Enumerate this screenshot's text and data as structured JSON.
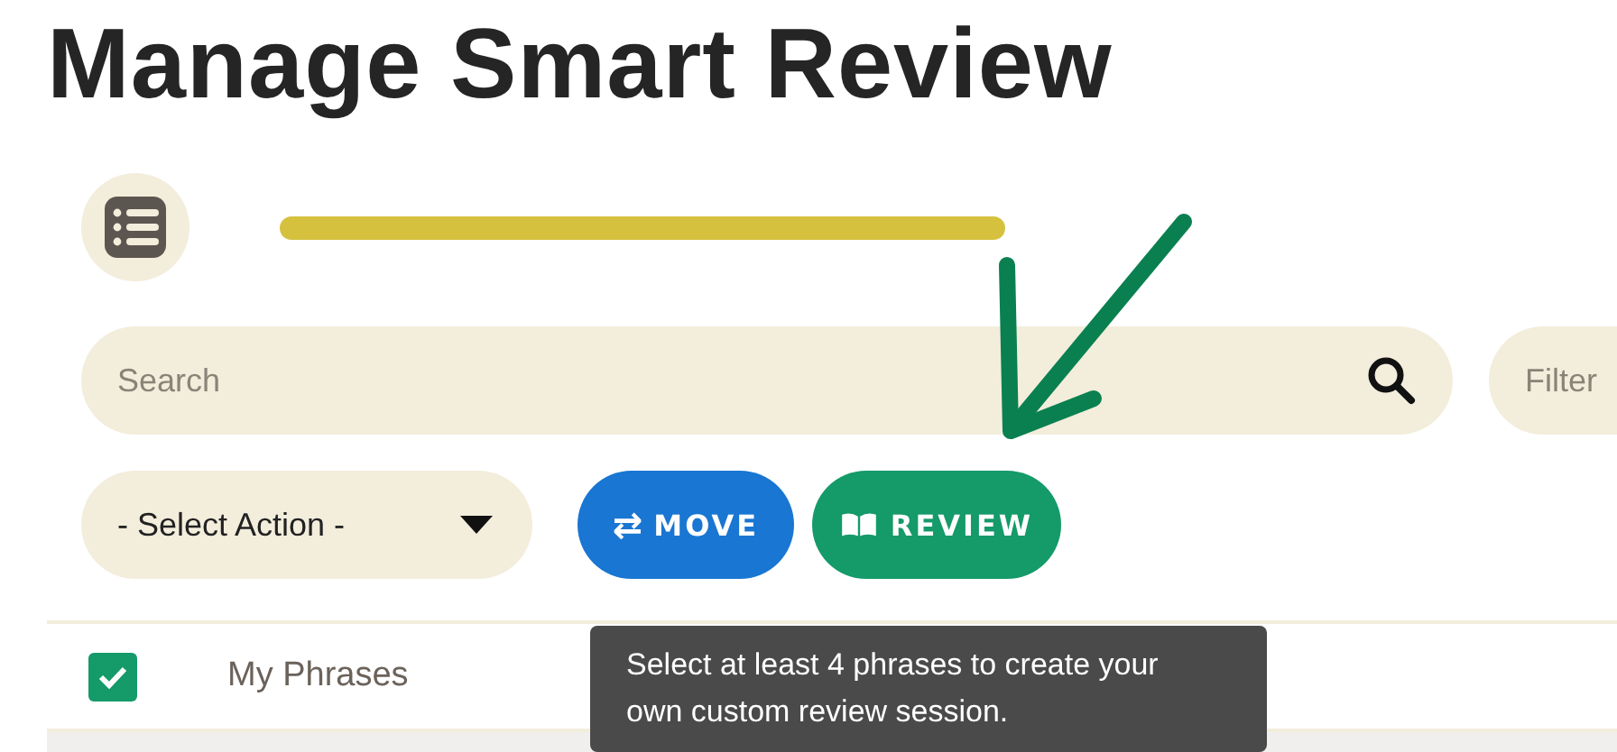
{
  "title": "Manage Smart Review",
  "search": {
    "placeholder": "Search"
  },
  "filter": {
    "placeholder": "Filter"
  },
  "action_select": {
    "value": "- Select Action -"
  },
  "buttons": [
    {
      "kind": "move",
      "icon": "⇄",
      "label": "MOVE"
    },
    {
      "kind": "review",
      "label": "REVIEW"
    }
  ],
  "rows": [
    {
      "label": "My Phrases",
      "checked": true
    }
  ],
  "tooltip": "Select at least 4 phrases to create your own custom review session."
}
